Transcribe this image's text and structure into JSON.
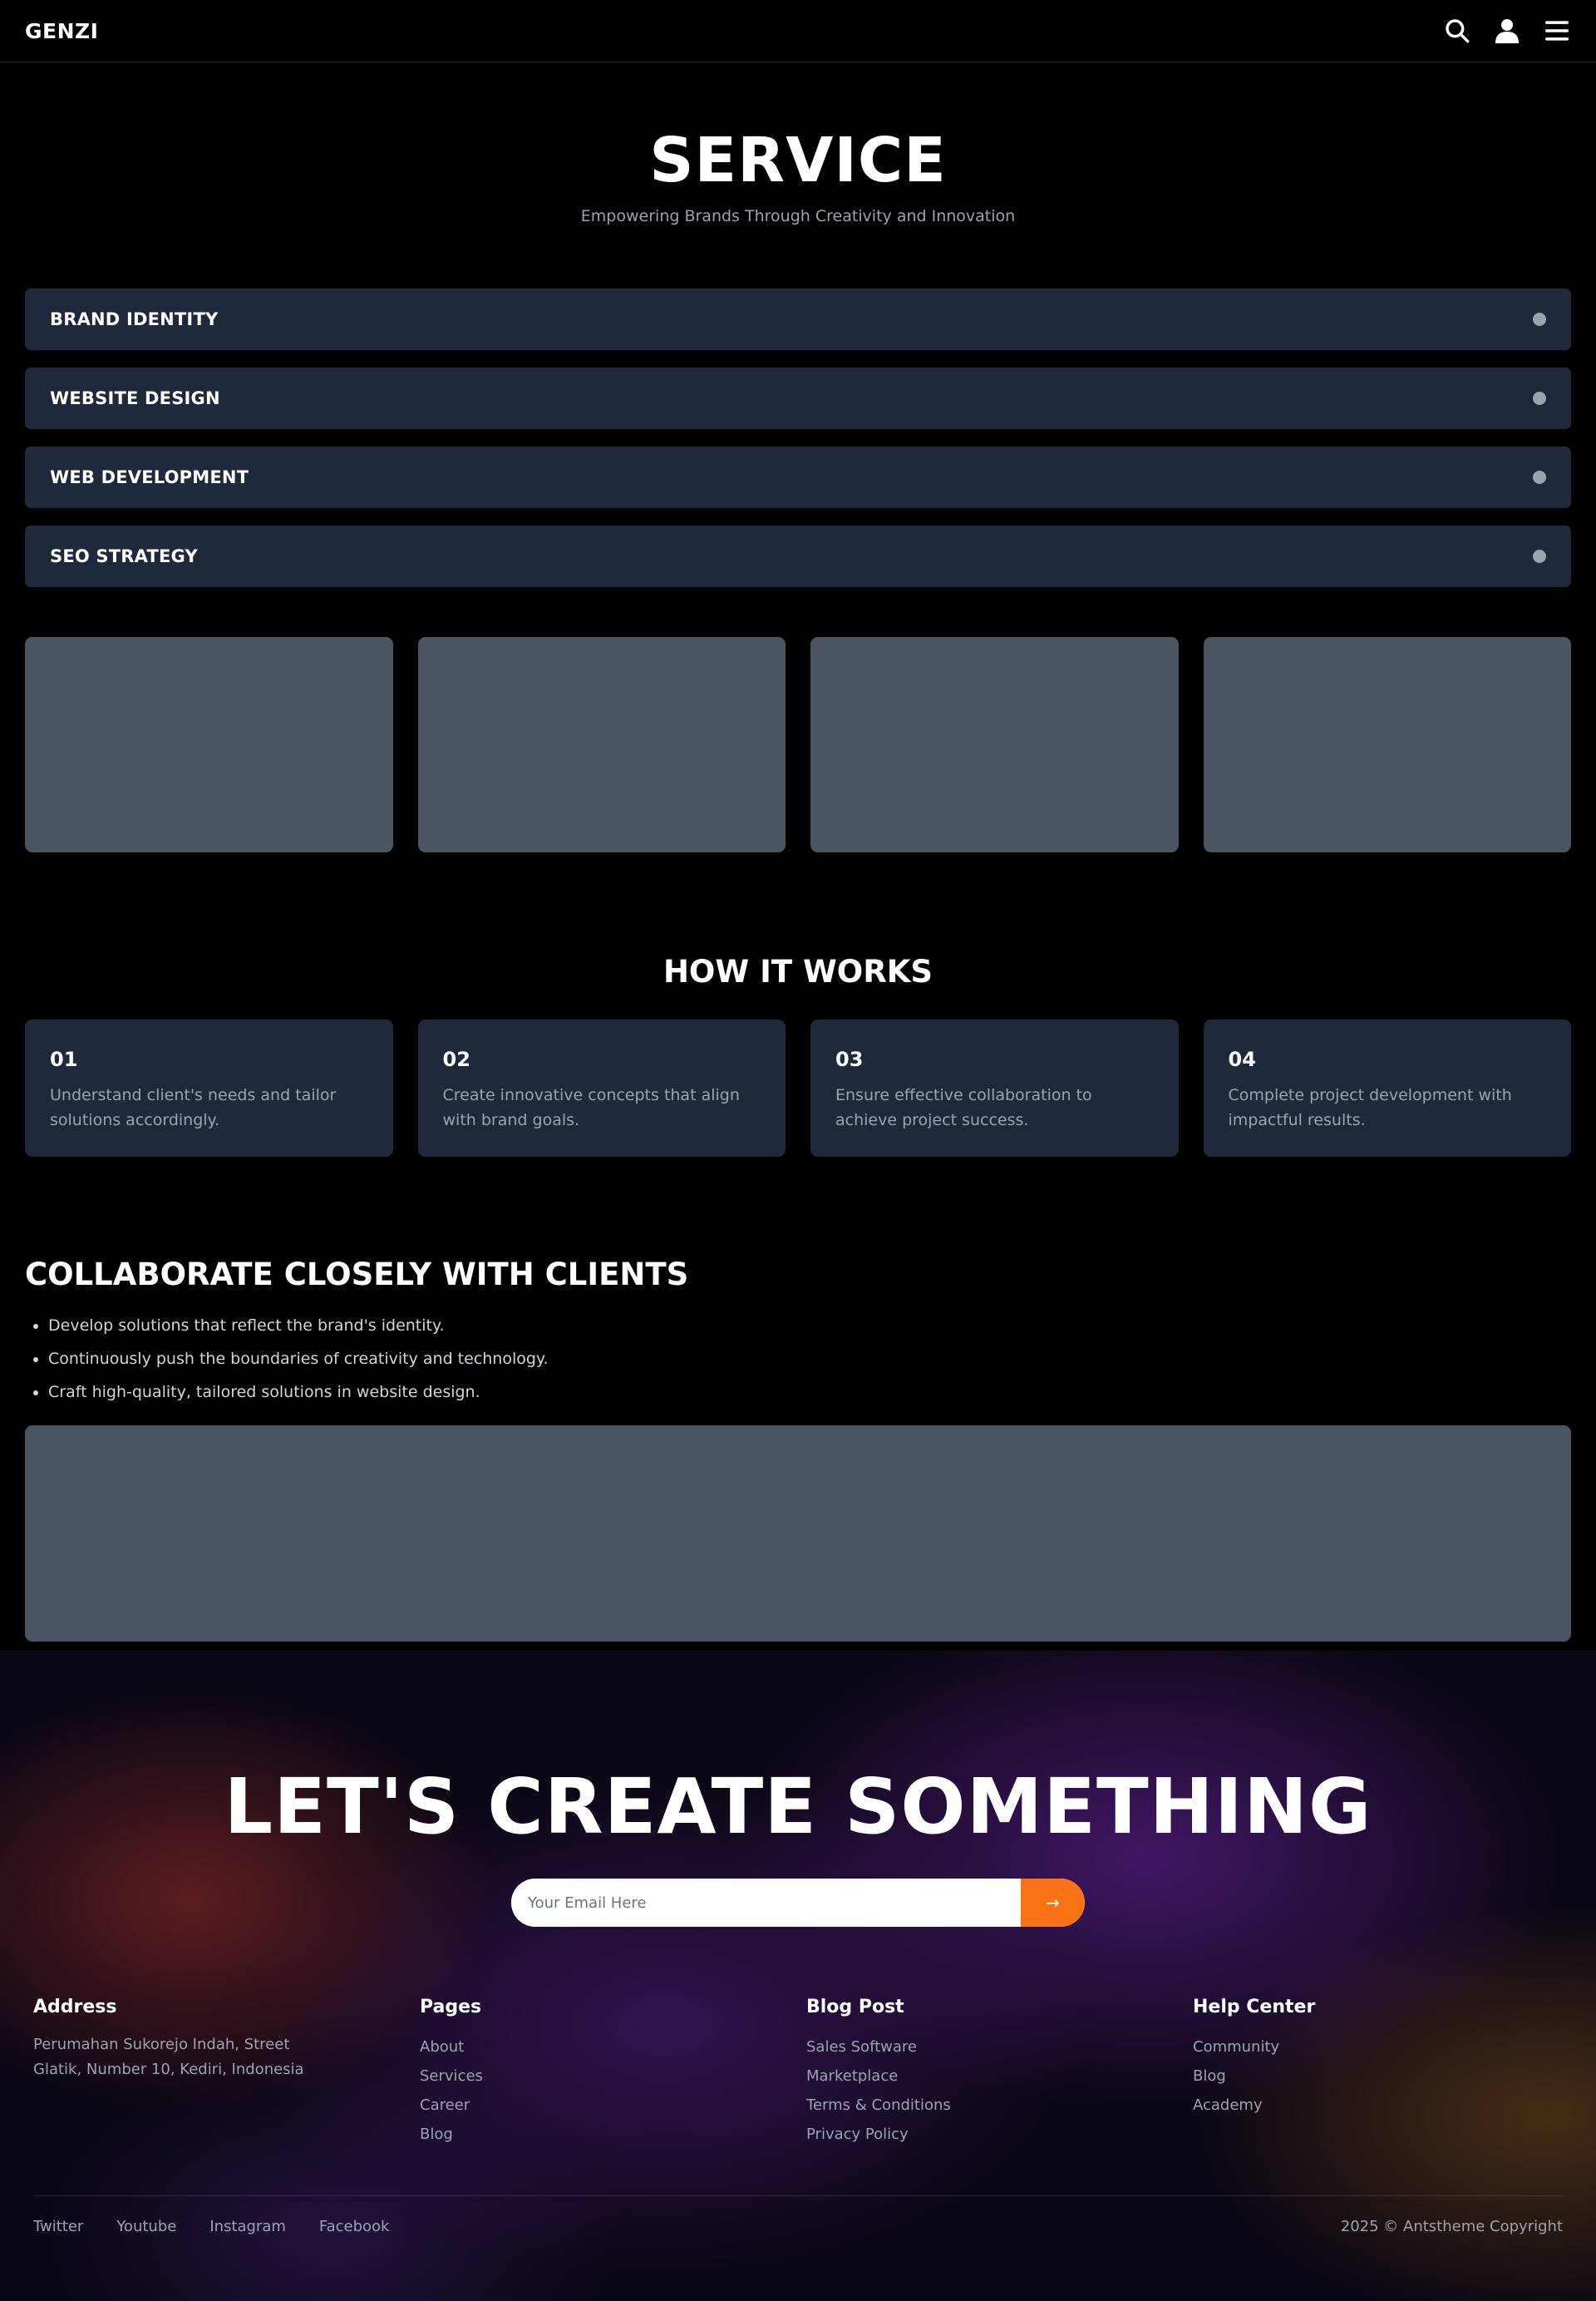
{
  "header": {
    "logo": "GENZI",
    "icons": [
      "search-icon",
      "user-icon",
      "menu-icon"
    ]
  },
  "service": {
    "title": "SERVICE",
    "subtitle": "Empowering Brands Through Creativity and Innovation",
    "items": [
      {
        "label": "BRAND IDENTITY"
      },
      {
        "label": "WEBSITE DESIGN"
      },
      {
        "label": "WEB DEVELOPMENT"
      },
      {
        "label": "SEO STRATEGY"
      }
    ]
  },
  "how_it_works": {
    "title": "HOW IT WORKS",
    "steps": [
      {
        "num": "01",
        "text": "Understand client's needs and tailor solutions accordingly."
      },
      {
        "num": "02",
        "text": "Create innovative concepts that align with brand goals."
      },
      {
        "num": "03",
        "text": "Ensure effective collaboration to achieve project success."
      },
      {
        "num": "04",
        "text": "Complete project development with impactful results."
      }
    ]
  },
  "collaborate": {
    "title": "COLLABORATE CLOSELY WITH CLIENTS",
    "points": [
      "Develop solutions that reflect the brand's identity.",
      "Continuously push the boundaries of creativity and technology.",
      "Craft high-quality, tailored solutions in website design."
    ]
  },
  "cta": {
    "title": "LET'S CREATE SOMETHING",
    "email_placeholder": "Your Email Here",
    "submit_label": "→"
  },
  "footer": {
    "address": {
      "title": "Address",
      "text": "Perumahan Sukorejo Indah, Street Glatik, Number 10, Kediri, Indonesia"
    },
    "pages": {
      "title": "Pages",
      "links": [
        "About",
        "Services",
        "Career",
        "Blog"
      ]
    },
    "blog_post": {
      "title": "Blog Post",
      "links": [
        "Sales Software",
        "Marketplace",
        "Terms & Conditions",
        "Privacy Policy"
      ]
    },
    "help_center": {
      "title": "Help Center",
      "links": [
        "Community",
        "Blog",
        "Academy"
      ]
    },
    "socials": [
      "Twitter",
      "Youtube",
      "Instagram",
      "Facebook"
    ],
    "copyright": "2025 © Antstheme Copyright"
  },
  "colors": {
    "background": "#000000",
    "card": "#1e293b",
    "placeholder": "#4b5563",
    "accent": "#f97316",
    "muted_text": "#9ca3af"
  }
}
